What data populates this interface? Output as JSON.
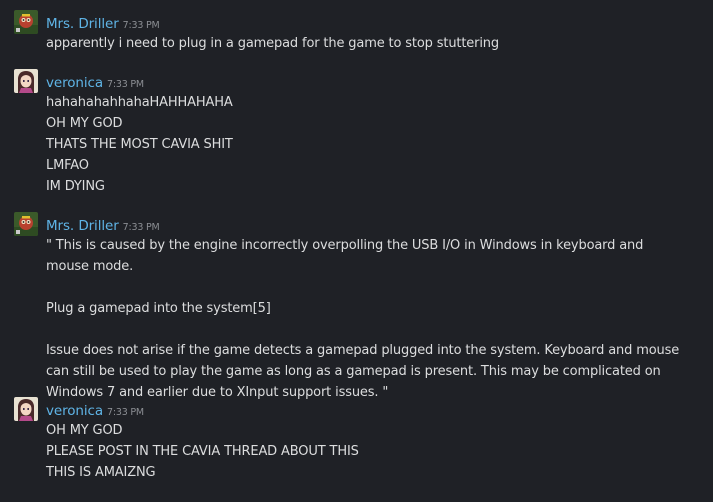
{
  "colors": {
    "background": "#1f2126",
    "text": "#dcddde",
    "timestamp": "#8b8e93",
    "author_name": "#5fb4e6"
  },
  "messages": [
    {
      "author": "Mrs. Driller",
      "avatar": "mrs-driller-avatar",
      "time": "7:33 PM",
      "lines": [
        "apparently i need to plug in a gamepad for the game to stop stuttering"
      ]
    },
    {
      "author": "veronica",
      "avatar": "veronica-avatar",
      "time": "7:33 PM",
      "lines": [
        "hahahahahhahaHAHHAHAHA",
        "OH MY GOD",
        "THATS THE MOST CAVIA SHIT",
        "LMFAO",
        "IM DYING"
      ]
    },
    {
      "author": "Mrs. Driller",
      "avatar": "mrs-driller-avatar",
      "time": "7:33 PM",
      "lines": [
        "\" This is caused by the engine incorrectly overpolling the USB I/O in Windows in keyboard and",
        "mouse mode.",
        "",
        "Plug a gamepad into the system[5]",
        "",
        "Issue does not arise if the game detects a gamepad plugged into the system. Keyboard and mouse",
        "can still be used to play the game as long as a gamepad is present. This may be complicated on",
        "Windows 7 and earlier due to XInput support issues. \""
      ]
    },
    {
      "author": "veronica",
      "avatar": "veronica-avatar",
      "time": "7:33 PM",
      "lines": [
        "OH MY GOD",
        "PLEASE POST IN THE CAVIA THREAD ABOUT THIS",
        "THIS IS AMAIZNG"
      ]
    }
  ]
}
